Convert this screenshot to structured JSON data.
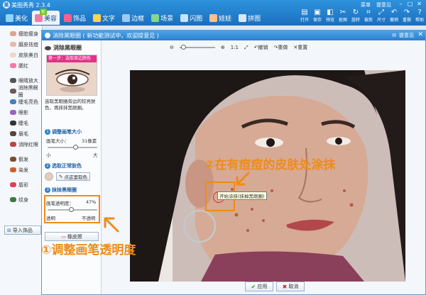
{
  "app": {
    "title": "美图秀秀 2.3.4",
    "top_links": [
      "菜单",
      "提意见"
    ],
    "tabs": [
      {
        "label": "美化",
        "active": false
      },
      {
        "label": "美容",
        "active": true,
        "badge": "新"
      },
      {
        "label": "饰品",
        "active": false
      },
      {
        "label": "文字",
        "active": false
      },
      {
        "label": "边框",
        "active": false
      },
      {
        "label": "场景",
        "active": false
      },
      {
        "label": "闪图",
        "active": false
      },
      {
        "label": "娃娃",
        "active": false
      },
      {
        "label": "拼图",
        "active": false
      }
    ],
    "toolbar": [
      "打开",
      "保存",
      "预览",
      "抠图",
      "旋转",
      "裁剪",
      "尺寸",
      "撤销",
      "重做",
      "帮助"
    ]
  },
  "sidebar": {
    "items": [
      "瘦脸瘦身",
      "磨皮祛痘",
      "皮肤美白",
      "腮红",
      "眼睛放大",
      "消除黑眼圈",
      "睫毛亮色",
      "眼影",
      "睫毛",
      "眉毛",
      "消除红眼",
      "假发",
      "染发",
      "唇彩",
      "纹身"
    ],
    "import_label": "导入饰品"
  },
  "dialog": {
    "title": "消除黑眼圈 ( 新功能测试中，欢迎提意见 )",
    "feedback": "提意见",
    "panel": {
      "heading": "消除黑眼圈",
      "preview_banner": "第一步：选取周边颜色",
      "description": "选取黑眼圈旁边的较亮肤色，再抹抹黑眼圈。",
      "step1": {
        "title": "调整画笔大小",
        "size_label": "画笔大小：",
        "size_value": "31像素",
        "min": "小",
        "max": "大",
        "level": 0.55
      },
      "step2": {
        "title": "选取正常肤色",
        "auto_button": "点这里取色",
        "swatch_color": "#e6cdb9"
      },
      "step3": {
        "title": "抹抹黑眼圈",
        "opacity_label": "画笔透明度：",
        "opacity_value": "47%",
        "min": "透明",
        "max": "不透明",
        "level": 0.47
      },
      "eraser_button": "橡皮擦"
    },
    "canvas_toolbar": {
      "ratio": "1:1",
      "undo": "撤销",
      "redo": "重做",
      "reset": "重置"
    },
    "tooltip": "开始涂抹(抹掉黑眼圈)",
    "buttons": {
      "apply": "应用",
      "cancel": "取消"
    }
  },
  "annotations": {
    "callout1": "①调整画笔透明度",
    "callout2": "②在有痘痘的皮肤处涂抹"
  },
  "colors": {
    "accent": "#2a7fcf",
    "highlight": "#f08b18"
  }
}
